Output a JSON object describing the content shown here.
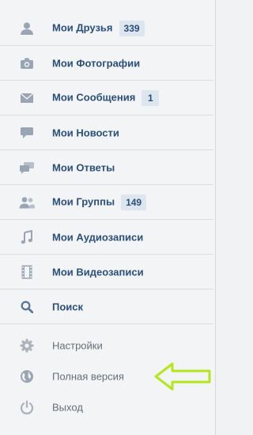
{
  "menu": {
    "items": [
      {
        "label": "Мои Друзья",
        "badge": "339",
        "icon": "user-icon"
      },
      {
        "label": "Мои Фотографии",
        "icon": "camera-icon"
      },
      {
        "label": "Мои Сообщения",
        "badge": "1",
        "icon": "envelope-icon"
      },
      {
        "label": "Мои Новости",
        "icon": "speech-bubble-icon"
      },
      {
        "label": "Мои Ответы",
        "icon": "speech-bubbles-icon"
      },
      {
        "label": "Мои Группы",
        "badge": "149",
        "icon": "group-icon"
      },
      {
        "label": "Мои Аудиозаписи",
        "icon": "music-note-icon"
      },
      {
        "label": "Мои Видеозаписи",
        "icon": "film-icon"
      },
      {
        "label": "Поиск",
        "icon": "search-icon"
      }
    ],
    "secondary": [
      {
        "label": "Настройки",
        "icon": "gear-icon"
      },
      {
        "label": "Полная версия",
        "icon": "globe-icon"
      },
      {
        "label": "Выход",
        "icon": "power-icon"
      }
    ]
  },
  "colors": {
    "primary_text": "#2b4f7a",
    "secondary_text": "#666e77",
    "badge_bg": "#dde5ee",
    "arrow": "#b5e61d"
  }
}
